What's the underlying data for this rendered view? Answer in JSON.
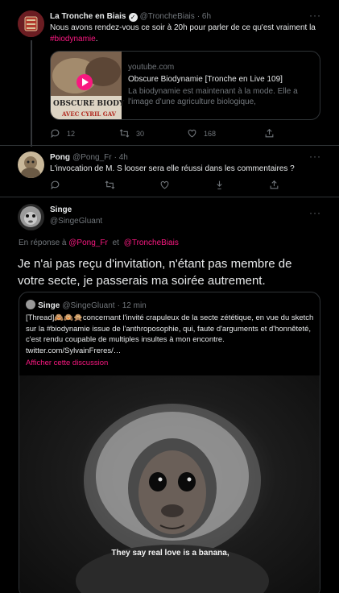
{
  "tweet1": {
    "name": "La Tronche en Biais",
    "handle": "@TroncheBiais",
    "time": "· 6h",
    "text": "Nous avons rendez-vous ce soir à 20h pour parler de ce qu'est vraiment la",
    "hashtag": "#biodynamie",
    "text_end": ".",
    "card": {
      "domain": "youtube.com",
      "title": "Obscure Biodynamie [Tronche en Live 109]",
      "desc": "La biodynamie est maintenant à la mode. Elle a l'image d'une agriculture biologique, respectueuse...",
      "thumb_title": "OBSCURE BIODY",
      "thumb_sub": "AVEC CYRIL GAV"
    },
    "replies": "12",
    "retweets": "30",
    "likes": "168"
  },
  "tweet2": {
    "name": "Pong",
    "handle": "@Pong_Fr",
    "time": "· 4h",
    "text": "L'invocation de M. S looser sera elle réussi dans les commentaires ?"
  },
  "tweet3": {
    "name": "Singe",
    "handle": "@SingeGluant",
    "reply_prefix": "En réponse à",
    "reply_to1": "@Pong_Fr",
    "reply_and": "et",
    "reply_to2": "@TroncheBiais",
    "text": "Je n'ai pas reçu d'invitation, n'étant pas membre de votre secte, je passerais ma soirée autrement.",
    "quote": {
      "name": "Singe",
      "handle": "@SingeGluant",
      "time": "· 12 min",
      "text": "[Thread]🙈🙉🙊concernant l'invité crapuleux de la secte zététique, en vue du sketch sur la #biodynamie issue de l'anthroposophie, qui, faute d'arguments et d'honnêteté, c'est rendu coupable de multiples insultes à mon encontre. twitter.com/SylvainFreres/…",
      "show_thread": "Afficher cette discussion",
      "subtitle": "They say real love is a banana,"
    }
  },
  "more": "···",
  "colors": {
    "accent": "#f91880",
    "muted": "#71767b",
    "bg": "#000000"
  }
}
